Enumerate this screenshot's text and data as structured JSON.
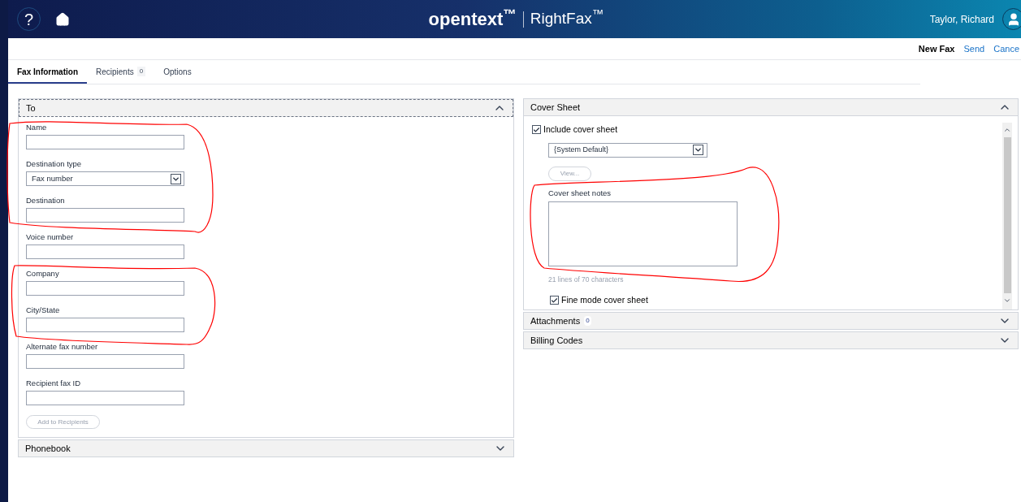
{
  "header": {
    "help": "?",
    "logo": "opentext$^{™}$",
    "product": "RightFax$^{™}$",
    "user": "Taylor, Richard"
  },
  "actions": [
    {
      "label": "New Fax",
      "kind": "title"
    },
    {
      "label": "Send",
      "kind": "link"
    },
    {
      "label": "Cance",
      "kind": "link"
    }
  ],
  "tabs": [
    {
      "label": "Fax Information",
      "selected": true
    },
    {
      "label": "Recipients",
      "count": "0",
      "selected": false
    },
    {
      "label": "Options",
      "selected": false
    }
  ],
  "to_panel": {
    "title": "To",
    "expanded": true,
    "fields": [
      {
        "label": "Name",
        "kind": "text"
      },
      {
        "label": "Destination type",
        "kind": "select",
        "value": "Fax number"
      },
      {
        "label": "Destination",
        "kind": "text"
      },
      {
        "label": "Voice number",
        "kind": "text"
      },
      {
        "label": "Company",
        "kind": "text"
      },
      {
        "label": "City/State",
        "kind": "text"
      },
      {
        "label": "Alternate fax number",
        "kind": "text"
      },
      {
        "label": "Recipient fax ID",
        "kind": "text"
      }
    ],
    "button": "Add to Recipients"
  },
  "phonebook": {
    "title": "Phonebook",
    "expanded": false
  },
  "cover_sheet": {
    "title": "Cover Sheet",
    "expanded": true,
    "include": {
      "label": "Include cover sheet",
      "checked": true
    },
    "template": "{System Default}",
    "view_button": "View...",
    "notes_label": "Cover sheet notes",
    "notes_hint": "21 lines of 70 characters",
    "fine_mode": {
      "label": "Fine mode cover sheet",
      "checked": true
    }
  },
  "sections": [
    {
      "title": "Attachments",
      "count": "0",
      "expanded": false
    },
    {
      "title": "Billing Codes",
      "expanded": false
    }
  ]
}
